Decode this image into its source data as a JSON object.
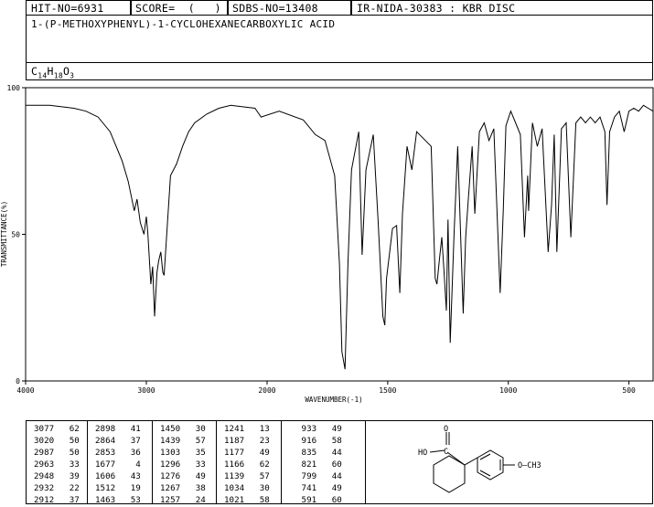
{
  "header": {
    "hit_no": "HIT-NO=6931",
    "score": "SCORE=  (   )",
    "sdbs_no": "SDBS-NO=13408",
    "ir_id": "IR-NIDA-30383 : KBR DISC",
    "compound_name": "1-(P-METHOXYPHENYL)-1-CYCLOHEXANECARBOXYLIC ACID",
    "formula": {
      "c": "C",
      "c_n": "14",
      "h": "H",
      "h_n": "18",
      "o": "O",
      "o_n": "3"
    }
  },
  "chart_data": {
    "type": "line",
    "xlabel": "WAVENUMBER(-1)",
    "ylabel": "TRANSMITTANCE(%)",
    "xlim": [
      4000,
      400
    ],
    "ylim": [
      0,
      100
    ],
    "x_ticks": [
      4000,
      3000,
      2000,
      1500,
      1000,
      500
    ],
    "y_ticks": [
      0,
      50,
      100
    ],
    "series": [
      {
        "x": [
          4000,
          3800,
          3600,
          3500,
          3400,
          3300,
          3200,
          3150,
          3100,
          3077,
          3050,
          3020,
          3000,
          2987,
          2963,
          2948,
          2932,
          2912,
          2898,
          2880,
          2864,
          2853,
          2800,
          2750,
          2700,
          2650,
          2600,
          2500,
          2400,
          2300,
          2100,
          2050,
          1950,
          1850,
          1800,
          1760,
          1720,
          1700,
          1690,
          1677,
          1665,
          1650,
          1620,
          1606,
          1590,
          1560,
          1540,
          1520,
          1512,
          1505,
          1480,
          1463,
          1450,
          1439,
          1420,
          1400,
          1380,
          1320,
          1303,
          1296,
          1285,
          1276,
          1267,
          1257,
          1250,
          1241,
          1225,
          1210,
          1187,
          1177,
          1166,
          1150,
          1139,
          1120,
          1100,
          1080,
          1060,
          1034,
          1021,
          1010,
          990,
          970,
          950,
          933,
          920,
          916,
          900,
          880,
          860,
          835,
          821,
          810,
          799,
          780,
          760,
          741,
          720,
          700,
          680,
          660,
          640,
          620,
          600,
          591,
          580,
          560,
          540,
          520,
          500,
          480,
          460,
          440,
          420,
          400
        ],
        "y": [
          94,
          94,
          93,
          92,
          90,
          85,
          75,
          68,
          58,
          62,
          54,
          50,
          56,
          50,
          33,
          39,
          22,
          37,
          41,
          44,
          37,
          36,
          70,
          74,
          80,
          85,
          88,
          91,
          93,
          94,
          93,
          90,
          92,
          89,
          84,
          82,
          70,
          40,
          10,
          4,
          40,
          72,
          85,
          43,
          72,
          84,
          55,
          22,
          19,
          35,
          52,
          53,
          30,
          57,
          80,
          72,
          85,
          80,
          35,
          33,
          42,
          49,
          38,
          24,
          55,
          13,
          50,
          80,
          23,
          49,
          62,
          80,
          57,
          85,
          88,
          82,
          86,
          30,
          58,
          87,
          92,
          88,
          84,
          49,
          70,
          58,
          88,
          80,
          86,
          44,
          60,
          84,
          44,
          86,
          88,
          49,
          88,
          90,
          88,
          90,
          88,
          90,
          85,
          60,
          85,
          90,
          92,
          85,
          92,
          93,
          92,
          94,
          93,
          92
        ]
      }
    ]
  },
  "peak_table": [
    [
      [
        "3077",
        "62"
      ],
      [
        "3020",
        "50"
      ],
      [
        "2987",
        "50"
      ],
      [
        "2963",
        "33"
      ],
      [
        "2948",
        "39"
      ],
      [
        "2932",
        "22"
      ],
      [
        "2912",
        "37"
      ]
    ],
    [
      [
        "2898",
        "41"
      ],
      [
        "2864",
        "37"
      ],
      [
        "2853",
        "36"
      ],
      [
        "1677",
        "4"
      ],
      [
        "1606",
        "43"
      ],
      [
        "1512",
        "19"
      ],
      [
        "1463",
        "53"
      ]
    ],
    [
      [
        "1450",
        "30"
      ],
      [
        "1439",
        "57"
      ],
      [
        "1303",
        "35"
      ],
      [
        "1296",
        "33"
      ],
      [
        "1276",
        "49"
      ],
      [
        "1267",
        "38"
      ],
      [
        "1257",
        "24"
      ]
    ],
    [
      [
        "1241",
        "13"
      ],
      [
        "1187",
        "23"
      ],
      [
        "1177",
        "49"
      ],
      [
        "1166",
        "62"
      ],
      [
        "1139",
        "57"
      ],
      [
        "1034",
        "30"
      ],
      [
        "1021",
        "58"
      ]
    ],
    [
      [
        "933",
        "49"
      ],
      [
        "916",
        "58"
      ],
      [
        "835",
        "44"
      ],
      [
        "821",
        "60"
      ],
      [
        "799",
        "44"
      ],
      [
        "741",
        "49"
      ],
      [
        "591",
        "60"
      ]
    ]
  ],
  "structure": {
    "label_ho": "HO",
    "label_c": "C",
    "label_o": "O",
    "label_ome": "O—CH3"
  }
}
